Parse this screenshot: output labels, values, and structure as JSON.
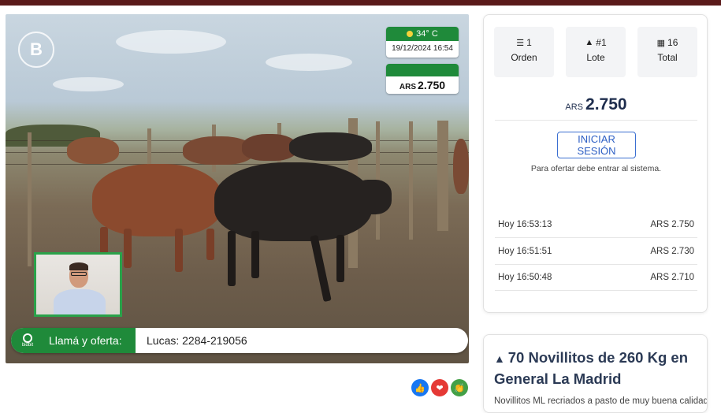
{
  "video": {
    "temperature": "34° C",
    "date_time": "19/12/2024  16:54",
    "price_currency": "ARS",
    "price_value": "2.750",
    "call_label": "Llamá y oferta:",
    "call_contact": "Lucas: 2284-219056",
    "bidbit_label": "bidbit"
  },
  "stats": [
    {
      "value": "1",
      "label": "Orden",
      "icon": "list-icon"
    },
    {
      "value": "#1",
      "label": "Lote",
      "icon": "cow-icon"
    },
    {
      "value": "16",
      "label": "Total",
      "icon": "boxes-icon"
    }
  ],
  "panel": {
    "price_currency": "ARS",
    "price_value": "2.750",
    "login_label": "INICIAR SESIÓN",
    "login_help": "Para ofertar debe entrar al sistema.",
    "bids": [
      {
        "time": "Hoy 16:53:13",
        "amount": "ARS 2.750"
      },
      {
        "time": "Hoy 16:51:51",
        "amount": "ARS 2.730"
      },
      {
        "time": "Hoy 16:50:48",
        "amount": "ARS 2.710"
      }
    ]
  },
  "lot": {
    "title": "70 Novillitos de 260 Kg en General La Madrid",
    "description": "Novillitos ML recriados a pasto de muy buena calidad"
  },
  "social": [
    {
      "icon": "thumbs-up-icon",
      "color": "#1877f2"
    },
    {
      "icon": "heart-icon",
      "color": "#e53935"
    },
    {
      "icon": "clap-icon",
      "color": "#43a047"
    }
  ],
  "colors": {
    "accent_green": "#1f8a3a",
    "top_bar": "#5a1a1a",
    "link_blue": "#2d5fc4"
  }
}
